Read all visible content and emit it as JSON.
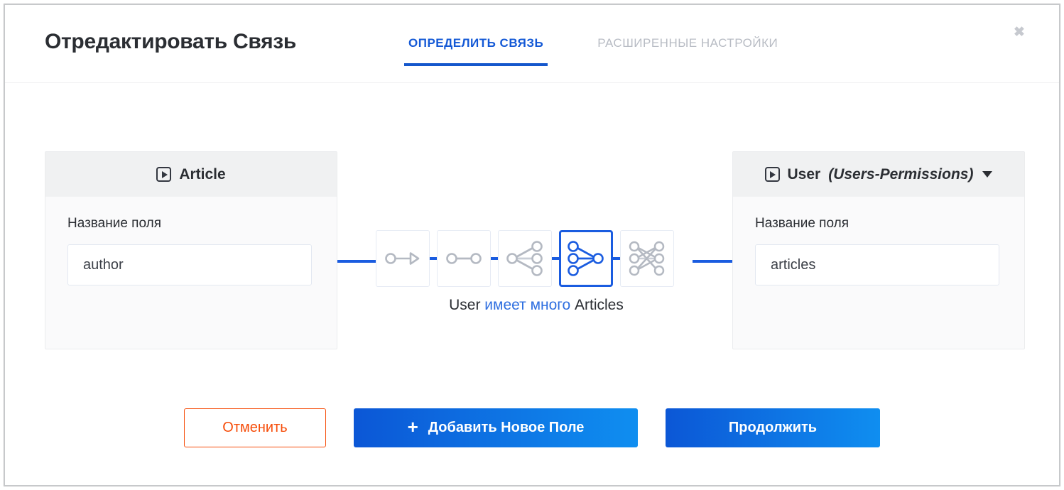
{
  "modal": {
    "title": "Отредактировать Связь",
    "close_icon": "close-icon",
    "close_glyph": "✖"
  },
  "tabs": [
    {
      "label": "ОПРЕДЕЛИТЬ СВЯЗЬ",
      "active": true
    },
    {
      "label": "РАСШИРЕННЫЕ НАСТРОЙКИ",
      "active": false
    }
  ],
  "left_card": {
    "entity_icon": "collection-type-icon",
    "entity_name": "Article",
    "field_label": "Название поля",
    "field_value": "author",
    "field_placeholder": ""
  },
  "right_card": {
    "entity_icon": "collection-type-icon",
    "entity_name": "User",
    "entity_sub": "(Users-Permissions)",
    "dropdown_icon": "chevron-down-icon",
    "field_label": "Название поля",
    "field_value": "articles",
    "field_placeholder": ""
  },
  "relation": {
    "options": [
      {
        "name": "has-one",
        "selected": false
      },
      {
        "name": "belongs-to-one",
        "selected": false
      },
      {
        "name": "has-many",
        "selected": false
      },
      {
        "name": "belongs-to-many",
        "selected": true
      },
      {
        "name": "many-to-many",
        "selected": false
      }
    ],
    "caption_prefix": "User",
    "caption_highlight": "имеет много",
    "caption_suffix": "Articles"
  },
  "footer": {
    "cancel_label": "Отменить",
    "add_field_icon": "plus-icon",
    "add_field_glyph": "✛",
    "add_field_label": "Добавить Новое Поле",
    "continue_label": "Продолжить"
  },
  "colors": {
    "accent_blue": "#1557cc",
    "line_blue": "#1a5ce0",
    "cancel_orange": "#f64d0a",
    "tab_inactive": "#b8bcc4",
    "card_header_bg": "#f0f1f2",
    "card_body_bg": "#fafafb"
  }
}
